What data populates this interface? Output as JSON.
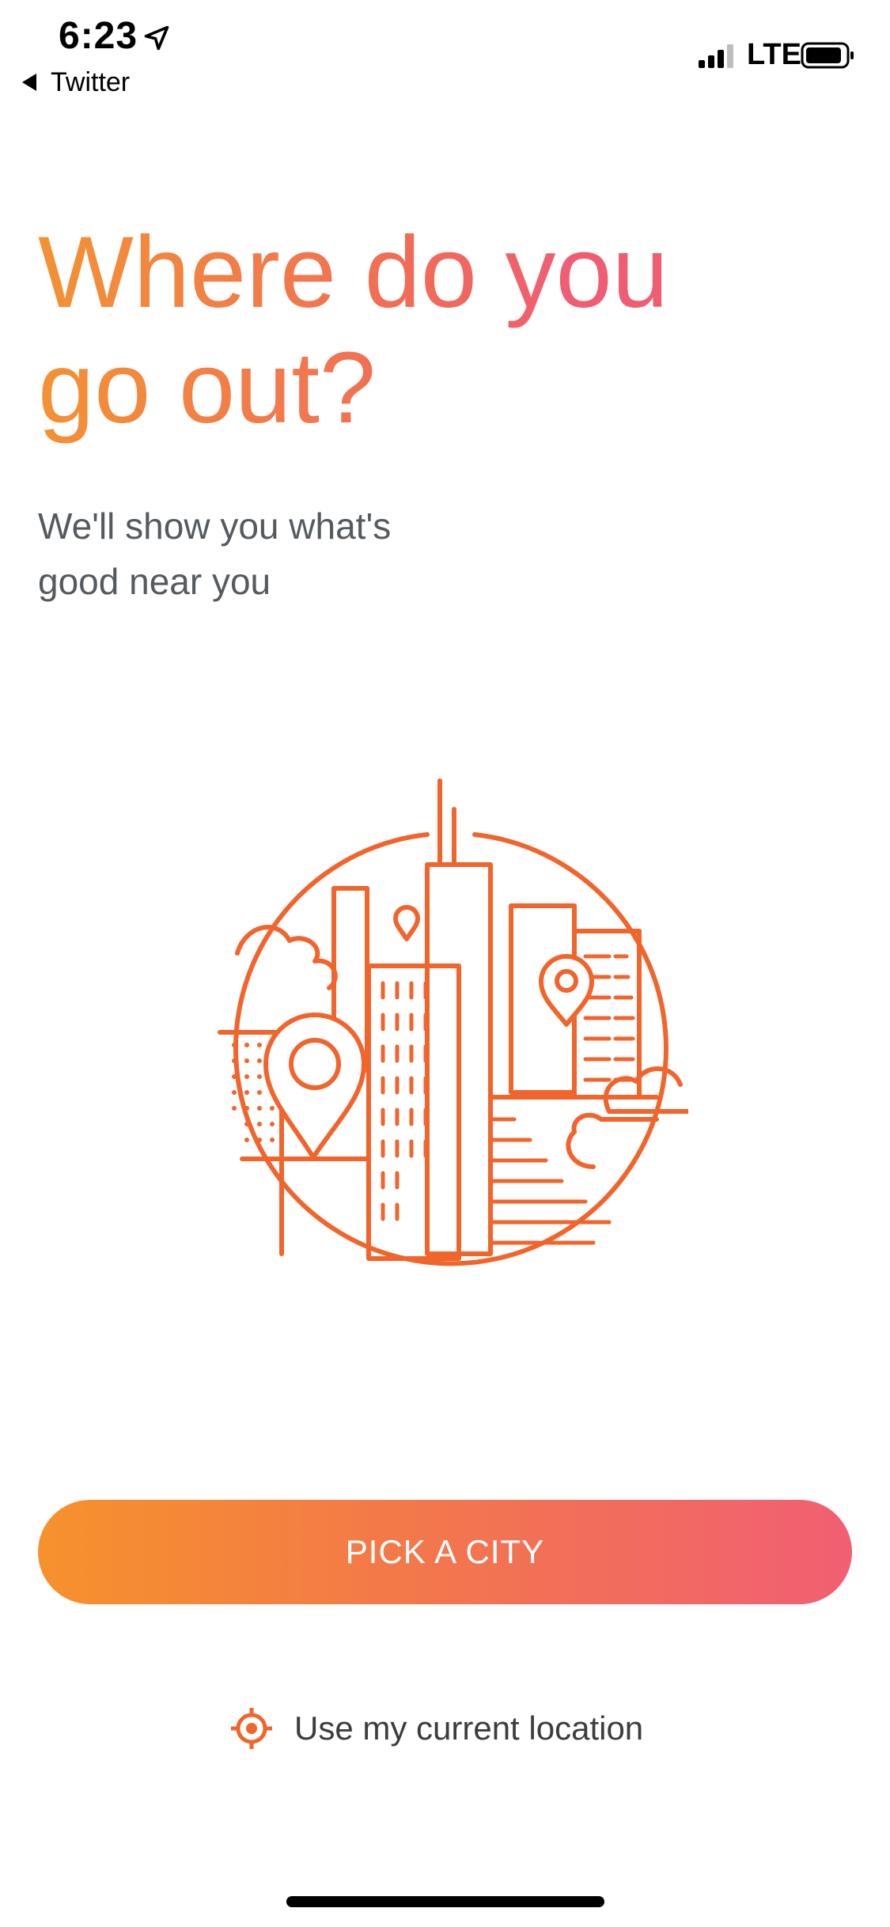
{
  "status_bar": {
    "time": "6:23",
    "back_app": "Twitter",
    "network": "LTE"
  },
  "main": {
    "title_line1": "Where do you",
    "title_line2": "go out?",
    "subtitle_line1": "We'll show you what's",
    "subtitle_line2": "good near you"
  },
  "actions": {
    "pick_city_label": "PICK A CITY",
    "current_location_label": "Use my current location"
  },
  "colors": {
    "accent_orange": "#f1652c",
    "gradient_start": "#f6922c",
    "gradient_end": "#f15f73",
    "subtitle_gray": "#555a5e"
  },
  "icons": {
    "location_arrow": "location-arrow-icon",
    "back": "back-triangle-icon",
    "signal": "signal-icon",
    "battery": "battery-icon",
    "illustration": "city-map-illustration",
    "target": "crosshair-target-icon"
  }
}
